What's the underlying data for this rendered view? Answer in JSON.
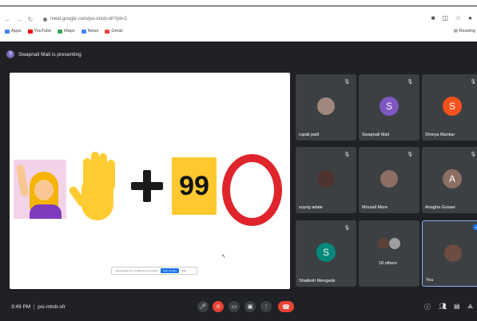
{
  "browser": {
    "url": "meet.google.com/psi-mtob-ofr?pli=1",
    "bookmarks": [
      {
        "label": "Apps",
        "color": "#4285f4"
      },
      {
        "label": "YouTube",
        "color": "#ff0000"
      },
      {
        "label": "Maps",
        "color": "#34a853"
      },
      {
        "label": "News",
        "color": "#4285f4"
      },
      {
        "label": "Gmail",
        "color": "#ea4335"
      }
    ],
    "reading_list": "Reading"
  },
  "presenter": {
    "initial": "S",
    "text": "Swapnali Mali is presenting"
  },
  "slide": {
    "number_badge": "99",
    "share_text": "meet.google.com is sharing your screen.",
    "stop_label": "Stop sharing",
    "hide_label": "Hide"
  },
  "participants": [
    {
      "name": "rupali patil",
      "initial": "",
      "color": "#a1887f",
      "type": "photo"
    },
    {
      "name": "Swapnali Mali",
      "initial": "S",
      "color": "#7e57c2",
      "type": "avatar"
    },
    {
      "name": "Shreya Mankar",
      "initial": "S",
      "color": "#f4511e",
      "type": "avatar"
    },
    {
      "name": "suyog adate",
      "initial": "",
      "color": "#4e342e",
      "type": "photo"
    },
    {
      "name": "Mrunali More",
      "initial": "",
      "color": "#8d6e63",
      "type": "photo"
    },
    {
      "name": "Anagha Gosavi",
      "initial": "A",
      "color": "#8d6e63",
      "type": "avatar"
    },
    {
      "name": "Shailesh Mengade",
      "initial": "S",
      "color": "#00897b",
      "type": "avatar"
    },
    {
      "name": "18 others",
      "initial": "",
      "color": "#5d4037",
      "type": "group"
    },
    {
      "name": "You",
      "initial": "",
      "color": "#6d4c41",
      "type": "photo"
    }
  ],
  "meeting": {
    "time": "3:49 PM",
    "code": "psi-mtob-ofr"
  },
  "colors": {
    "background": "#202124",
    "tile": "#3c4043",
    "danger": "#ea4335",
    "accent": "#1a73e8"
  }
}
